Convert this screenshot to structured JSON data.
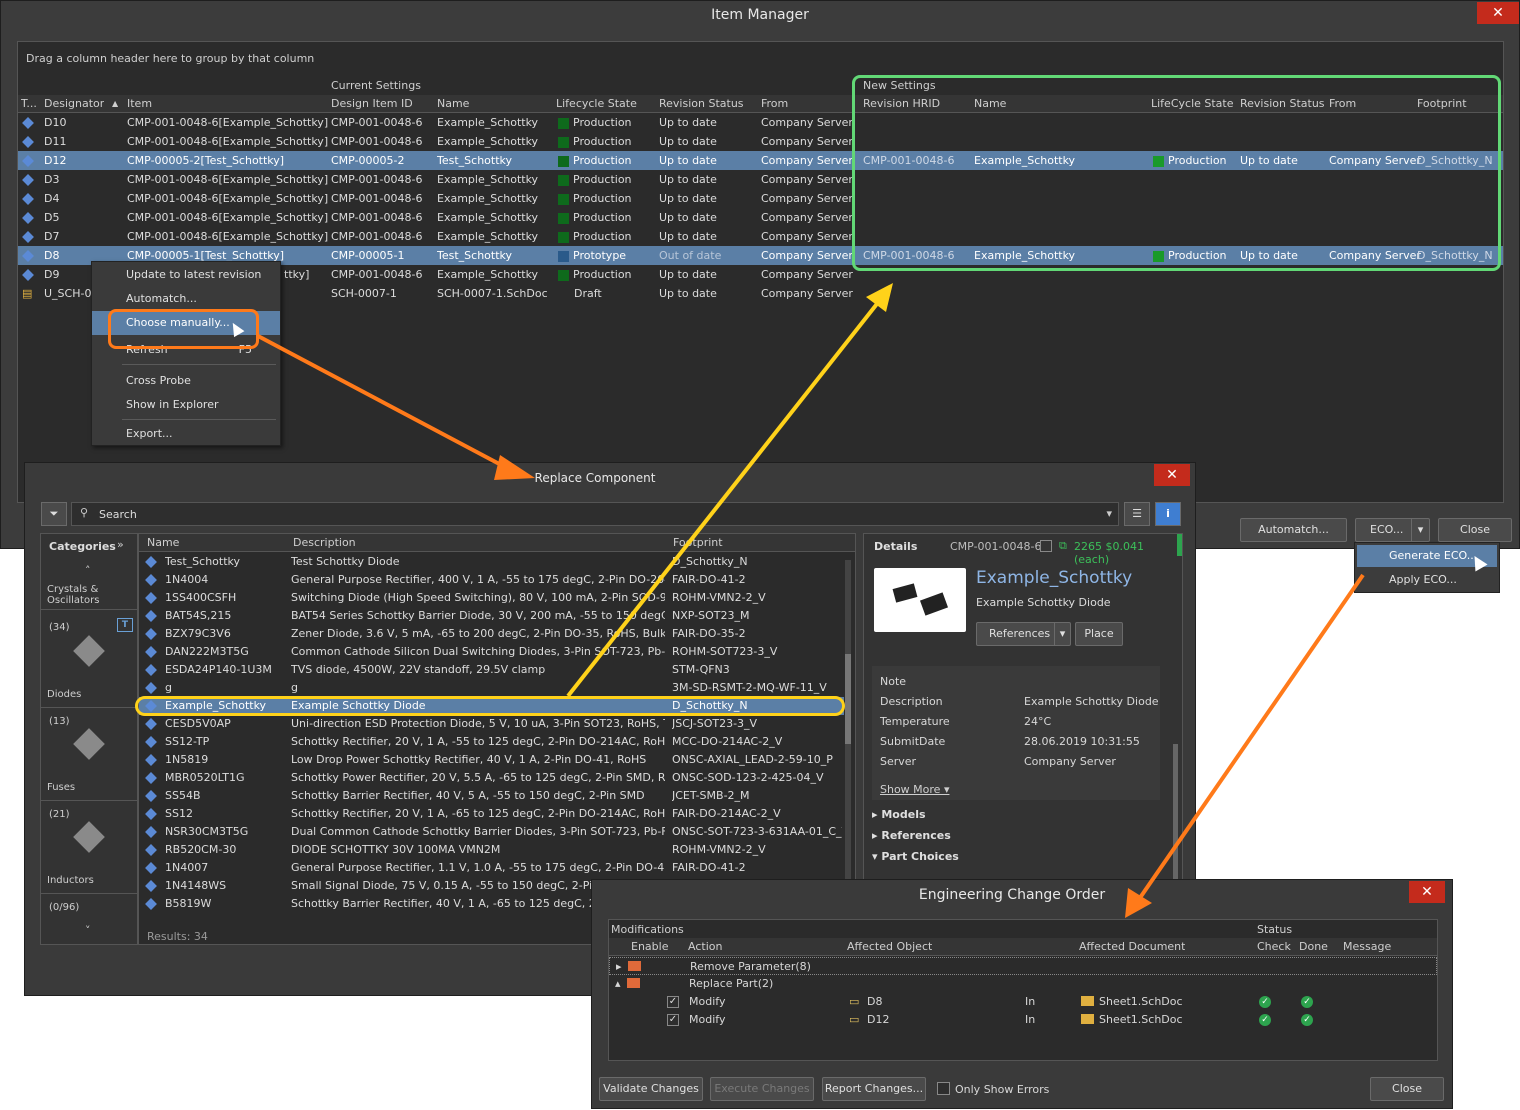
{
  "item_manager": {
    "title": "Item Manager",
    "close_glyph": "✕",
    "group_hint": "Drag a column header here to group by that column",
    "current_settings_label": "Current Settings",
    "new_settings_label": "New Settings",
    "headers": {
      "t": "T...",
      "designator": "Designator",
      "item": "Item",
      "design_item_id": "Design Item ID",
      "name": "Name",
      "lifecycle": "Lifecycle State",
      "revision": "Revision Status",
      "from": "From"
    },
    "new_headers": {
      "hrid": "Revision HRID",
      "name": "Name",
      "lifecycle": "LifeCycle State",
      "revision": "Revision Status",
      "from": "From",
      "footprint": "Footprint"
    },
    "rows": [
      {
        "designator": "D10",
        "item": "CMP-001-0048-6[Example_Schottky]",
        "id": "CMP-001-0048-6",
        "name": "Example_Schottky",
        "lifecycle": "Production",
        "revision": "Up to date",
        "from": "Company Server"
      },
      {
        "designator": "D11",
        "item": "CMP-001-0048-6[Example_Schottky]",
        "id": "CMP-001-0048-6",
        "name": "Example_Schottky",
        "lifecycle": "Production",
        "revision": "Up to date",
        "from": "Company Server"
      },
      {
        "designator": "D12",
        "item": "CMP-00005-2[Test_Schottky]",
        "id": "CMP-00005-2",
        "name": "Test_Schottky",
        "lifecycle": "Production",
        "revision": "Up to date",
        "from": "Company Server"
      },
      {
        "designator": "D3",
        "item": "CMP-001-0048-6[Example_Schottky]",
        "id": "CMP-001-0048-6",
        "name": "Example_Schottky",
        "lifecycle": "Production",
        "revision": "Up to date",
        "from": "Company Server"
      },
      {
        "designator": "D4",
        "item": "CMP-001-0048-6[Example_Schottky]",
        "id": "CMP-001-0048-6",
        "name": "Example_Schottky",
        "lifecycle": "Production",
        "revision": "Up to date",
        "from": "Company Server"
      },
      {
        "designator": "D5",
        "item": "CMP-001-0048-6[Example_Schottky]",
        "id": "CMP-001-0048-6",
        "name": "Example_Schottky",
        "lifecycle": "Production",
        "revision": "Up to date",
        "from": "Company Server"
      },
      {
        "designator": "D7",
        "item": "CMP-001-0048-6[Example_Schottky]",
        "id": "CMP-001-0048-6",
        "name": "Example_Schottky",
        "lifecycle": "Production",
        "revision": "Up to date",
        "from": "Company Server"
      },
      {
        "designator": "D8",
        "item": "CMP-00005-1[Test_Schottky]",
        "id": "CMP-00005-1",
        "name": "Test_Schottky",
        "lifecycle": "Prototype",
        "revision": "Out of date",
        "from": "Company Server"
      },
      {
        "designator": "D9",
        "item": "CMP-001-0048-6[Example_Schottky]",
        "id": "CMP-001-0048-6",
        "name": "Example_Schottky",
        "lifecycle": "Production",
        "revision": "Up to date",
        "from": "Company Server"
      },
      {
        "designator": "U_SCH-00",
        "item": "",
        "id": "SCH-0007-1",
        "name": "SCH-0007-1.SchDoc",
        "lifecycle": "Draft",
        "revision": "Up to date",
        "from": "Company Server"
      }
    ],
    "item_d9_tail": "ttky]",
    "new_rows": [
      {
        "hrid": "CMP-001-0048-6",
        "name": "Example_Schottky",
        "lifecycle": "Production",
        "revision": "Up to date",
        "from": "Company Server",
        "footprint": "D_Schottky_N"
      },
      {
        "hrid": "CMP-001-0048-6",
        "name": "Example_Schottky",
        "lifecycle": "Production",
        "revision": "Up to date",
        "from": "Company Server",
        "footprint": "D_Schottky_N"
      }
    ],
    "buttons": {
      "automatch": "Automatch...",
      "eco": "ECO...",
      "close": "Close"
    },
    "eco_menu": [
      "Generate ECO...",
      "Apply ECO..."
    ]
  },
  "context_menu": {
    "items": [
      "Update to latest revision",
      "Automatch...",
      "Choose manually...",
      "Refresh",
      "Cross Probe",
      "Show in Explorer",
      "Export..."
    ],
    "refresh_shortcut": "F5"
  },
  "replace_component": {
    "title": "Replace Component",
    "close_glyph": "✕",
    "search_placeholder": "Search",
    "categories_label": "Categories",
    "categories": [
      {
        "count": "",
        "label": "Crystals & Oscillators"
      },
      {
        "count": "(34)",
        "label": "Diodes"
      },
      {
        "count": "(13)",
        "label": "Fuses"
      },
      {
        "count": "(21)",
        "label": "Inductors"
      },
      {
        "count": "(0/96)",
        "label": ""
      }
    ],
    "headers": {
      "name": "Name",
      "description": "Description",
      "footprint": "Footprint"
    },
    "rows": [
      {
        "name": "Test_Schottky",
        "desc": "Test Schottky Diode",
        "fp": "D_Schottky_N"
      },
      {
        "name": "1N4004",
        "desc": "General Purpose Rectifier, 400 V, 1 A, -55 to 175 degC, 2-Pin DO-204AL (",
        "fp": "FAIR-DO-41-2"
      },
      {
        "name": "1SS400CSFH",
        "desc": "Switching Diode (High Speed Switching), 80 V, 100 mA, 2-Pin SOD-92...",
        "fp": "ROHM-VMN2-2_V"
      },
      {
        "name": "BAT54S,215",
        "desc": "BAT54 Series Schottky Barrier Diode, 30 V, 200 mA, -55 to 150 degC, 3-Pi...",
        "fp": "NXP-SOT23_M"
      },
      {
        "name": "BZX79C3V6",
        "desc": "Zener Diode, 3.6 V, 5 mA, -65 to 200 degC, 2-Pin DO-35, RoHS, Bulk",
        "fp": "FAIR-DO-35-2"
      },
      {
        "name": "DAN222M3T5G",
        "desc": "Common Cathode Silicon Dual Switching Diodes, 3-Pin SOT-723, Pb-Fr...",
        "fp": "ROHM-SOT723-3_V"
      },
      {
        "name": "ESDA24P140-1U3M",
        "desc": "TVS diode, 4500W, 22V standoff, 29.5V clamp",
        "fp": "STM-QFN3"
      },
      {
        "name": "g",
        "desc": "g",
        "fp": "3M-SD-RSMT-2-MQ-WF-11_V"
      },
      {
        "name": "Example_Schottky",
        "desc": "Example Schottky Diode",
        "fp": "D_Schottky_N"
      },
      {
        "name": "CESD5V0AP",
        "desc": "Uni-direction ESD Protection Diode, 5 V, 10 uA, 3-Pin SOT23, RoHS, Tap...",
        "fp": "JSCJ-SOT23-3_V"
      },
      {
        "name": "SS12-TP",
        "desc": "Schottky Rectifier, 20 V, 1 A, -55 to 125 degC, 2-Pin DO-214AC, RoHS, Ta...",
        "fp": "MCC-DO-214AC-2_V"
      },
      {
        "name": "1N5819",
        "desc": "Low Drop Power Schottky Rectifier, 40 V, 1 A, 2-Pin DO-41, RoHS",
        "fp": "ONSC-AXIAL_LEAD-2-59-10_P"
      },
      {
        "name": "MBR0520LT1G",
        "desc": "Schottky Power Rectifier, 20 V, 5.5 A, -65 to 125 degC, 2-Pin SMD, RoHS...",
        "fp": "ONSC-SOD-123-2-425-04_V"
      },
      {
        "name": "SS54B",
        "desc": "Schottky Barrier Rectifier, 40 V, 5 A, -55 to 150 degC, 2-Pin SMD",
        "fp": "JCET-SMB-2_M"
      },
      {
        "name": "SS12",
        "desc": "Schottky Rectifier, 20 V, 1 A, -65 to 125 degC, 2-Pin DO-214AC, RoHS, Ta...",
        "fp": "FAIR-DO-214AC-2_V"
      },
      {
        "name": "NSR30CM3T5G",
        "desc": "Dual Common Cathode Schottky Barrier Diodes, 3-Pin SOT-723, Pb-Free...",
        "fp": "ONSC-SOT-723-3-631AA-01_C_V"
      },
      {
        "name": "RB520CM-30",
        "desc": "DIODE SCHOTTKY 30V 100MA VMN2M",
        "fp": "ROHM-VMN2-2_V"
      },
      {
        "name": "1N4007",
        "desc": "General Purpose Rectifier, 1.1 V, 1.0 A, -55 to 175 degC, 2-Pin DO-41, R...",
        "fp": "FAIR-DO-41-2"
      },
      {
        "name": "1N4148WS",
        "desc": "Small Signal Diode, 75 V, 0.15 A, -55 to 150 degC, 2-Pin SOD",
        "fp": ""
      },
      {
        "name": "B5819W",
        "desc": "Schottky Barrier Rectifier, 40 V, 1 A, -65 to 125 degC, 2-Pin S",
        "fp": ""
      }
    ],
    "results": "Results: 34",
    "details": {
      "tab": "Details",
      "id": "CMP-001-0048-6",
      "stock": "2265",
      "price": "$0.041 (each)",
      "title": "Example_Schottky",
      "subtitle": "Example Schottky Diode",
      "references_btn": "References",
      "place_btn": "Place",
      "props": [
        {
          "k": "Note",
          "v": ""
        },
        {
          "k": "Description",
          "v": "Example Schottky Diode"
        },
        {
          "k": "Temperature",
          "v": "24°C"
        },
        {
          "k": "SubmitDate",
          "v": "28.06.2019 10:31:55"
        },
        {
          "k": "Server",
          "v": "Company Server"
        }
      ],
      "show_more": "Show More ▾",
      "sections": [
        "Models",
        "References",
        "Part Choices"
      ]
    }
  },
  "eco": {
    "title": "Engineering Change Order",
    "close_glyph": "✕",
    "modifications_label": "Modifications",
    "status_label": "Status",
    "headers": {
      "enable": "Enable",
      "action": "Action",
      "affected_object": "Affected Object",
      "affected_document": "Affected Document",
      "check": "Check",
      "done": "Done",
      "message": "Message"
    },
    "groups": [
      {
        "label": "Remove Parameter(8)"
      },
      {
        "label": "Replace Part(2)"
      }
    ],
    "rows": [
      {
        "action": "Modify",
        "object": "D8",
        "in": "In",
        "document": "Sheet1.SchDoc"
      },
      {
        "action": "Modify",
        "object": "D12",
        "in": "In",
        "document": "Sheet1.SchDoc"
      }
    ],
    "buttons": {
      "validate": "Validate Changes",
      "execute": "Execute Changes",
      "report": "Report Changes...",
      "only_errors": "Only Show Errors",
      "close": "Close"
    }
  },
  "colors": {
    "highlight_green": "#62d876",
    "highlight_orange": "#ff7a1a",
    "highlight_yellow": "#ffd21a",
    "selection": "#5b7fa6",
    "close_red": "#c42b1c"
  }
}
